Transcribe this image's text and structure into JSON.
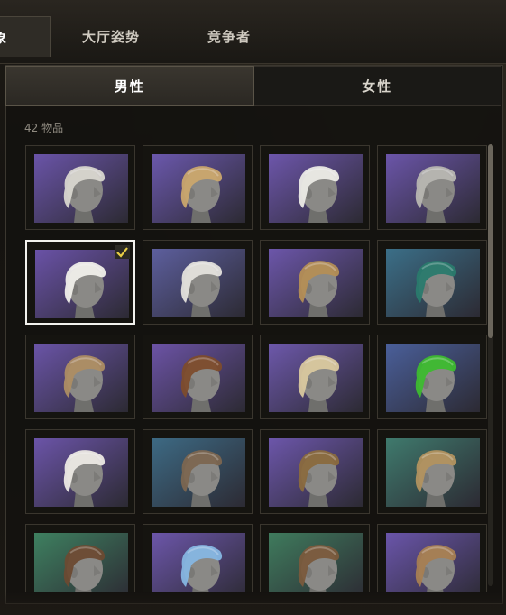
{
  "tabs": [
    {
      "label": "象",
      "active": true
    },
    {
      "label": "大厅姿势",
      "active": false
    },
    {
      "label": "竞争者",
      "active": false
    }
  ],
  "gender_tabs": [
    {
      "label": "男性",
      "active": true
    },
    {
      "label": "女性",
      "active": false
    }
  ],
  "item_count": "42 物品",
  "hairstyles": [
    {
      "icon": "hairstyle-messy-white-tied",
      "bg": "#6a54a8",
      "hair": "#d8d6cf",
      "selected": false
    },
    {
      "icon": "hairstyle-blonde-shoulder",
      "bg": "#6b58ad",
      "hair": "#caa76d",
      "selected": false
    },
    {
      "icon": "hairstyle-white-fringe",
      "bg": "#6d56ab",
      "hair": "#ecebe6",
      "selected": false
    },
    {
      "icon": "hairstyle-silver-bob",
      "bg": "#6b55a9",
      "hair": "#b7b6b1",
      "selected": false
    },
    {
      "icon": "hairstyle-white-braid",
      "bg": "#6a52a7",
      "hair": "#f0efea",
      "selected": true
    },
    {
      "icon": "hairstyle-white-wavy",
      "bg": "#5d5f9e",
      "hair": "#e4e2dc",
      "selected": false
    },
    {
      "icon": "hairstyle-braided-crown",
      "bg": "#6c56aa",
      "hair": "#b48e55",
      "selected": false
    },
    {
      "icon": "hairstyle-teal-bob",
      "bg": "#3b6f88",
      "hair": "#2a7a6d",
      "selected": false
    },
    {
      "icon": "hairstyle-sandy-curtain",
      "bg": "#6a54a7",
      "hair": "#ad8d63",
      "selected": false
    },
    {
      "icon": "hairstyle-braided-side",
      "bg": "#6c53a6",
      "hair": "#7d4c2c",
      "selected": false
    },
    {
      "icon": "hairstyle-long-platinum",
      "bg": "#6d58ab",
      "hair": "#d9c89e",
      "selected": false
    },
    {
      "icon": "hairstyle-green-slick",
      "bg": "#4a5f9a",
      "hair": "#3dbb2f",
      "selected": false
    },
    {
      "icon": "hairstyle-white-ponytail",
      "bg": "#6b54a8",
      "hair": "#ece9e4",
      "selected": false
    },
    {
      "icon": "hairstyle-long-wavy-brown",
      "bg": "#3d6a84",
      "hair": "#7c6650",
      "selected": false
    },
    {
      "icon": "hairstyle-leopard-crop",
      "bg": "#6c56aa",
      "hair": "#8a6a3e",
      "selected": false
    },
    {
      "icon": "hairstyle-long-straight-blonde",
      "bg": "#3f7a6d",
      "hair": "#b2925f",
      "selected": false
    },
    {
      "icon": "hairstyle-undercut-topknot",
      "bg": "#3e8060",
      "hair": "#6b4a32",
      "selected": false
    },
    {
      "icon": "hairstyle-blue-flower",
      "bg": "#6c56aa",
      "hair": "#86b6e2",
      "selected": false
    },
    {
      "icon": "hairstyle-cornrows-bun",
      "bg": "#3f7b5d",
      "hair": "#7a5a3c",
      "selected": false
    },
    {
      "icon": "hairstyle-braided-back",
      "bg": "#6a55aa",
      "hair": "#a67e52",
      "selected": false
    }
  ],
  "selected_mark": "✓"
}
